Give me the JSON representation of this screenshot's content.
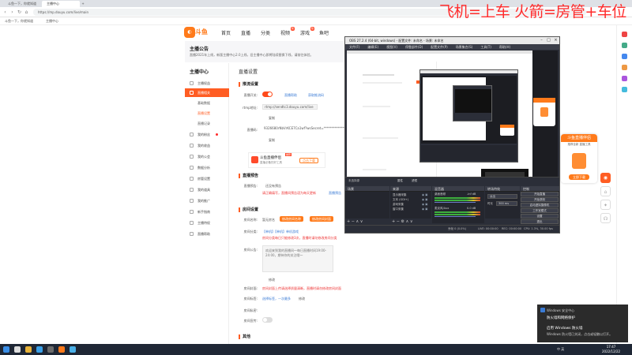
{
  "browser": {
    "tabs": [
      {
        "label": "斗鱼一下，你就知道"
      },
      {
        "label": "主播中心"
      }
    ],
    "url": "https://mp.douyu.com/live/main",
    "bookmarks": [
      "斗鱼一下，你就知道",
      "主播中心"
    ]
  },
  "overlay_text": "飞机=上车  火箭=房管+车位",
  "site": {
    "logo": "斗鱼",
    "nav": [
      "首页",
      "直播",
      "分类",
      "视频",
      "游戏",
      "鱼吧"
    ],
    "nav_badges": {
      "视频": "新",
      "游戏": "热"
    }
  },
  "banner": {
    "title": "主播公告",
    "desc": "直播2021年上线，新版主播中心2.0上线，旧主播中心即将陆续替换下线，请前往体验。"
  },
  "sidebar": {
    "heading": "主播中心",
    "items": [
      {
        "label": "主播权益",
        "active": false
      },
      {
        "label": "直播相关",
        "active": true
      }
    ],
    "subitems": [
      {
        "label": "基础数据",
        "active": false
      },
      {
        "label": "直播设置",
        "active": true
      },
      {
        "label": "直播记录",
        "active": false
      }
    ],
    "items2": [
      {
        "label": "我的粉丝",
        "dot": true
      },
      {
        "label": "我的收益",
        "dot": false
      },
      {
        "label": "我的公会",
        "dot": false
      },
      {
        "label": "数据分析",
        "dot": false
      },
      {
        "label": "房管设置",
        "dot": false
      },
      {
        "label": "我的道具",
        "dot": false
      },
      {
        "label": "我的推广",
        "dot": false
      },
      {
        "label": "新手指南",
        "dot": false
      },
      {
        "label": "主播特权",
        "dot": false
      },
      {
        "label": "直播帮助",
        "dot": false
      }
    ]
  },
  "content": {
    "title": "直播设置",
    "stream": {
      "heading": "推流设置",
      "switch_label": "直播开关:",
      "switch_links": [
        "直播帮助",
        "获取推流码"
      ],
      "rtmp_label": "rtmp地址:",
      "rtmp_value": "rtmp://sendtc3.douyu.com/live",
      "copy1": "复制",
      "code_label": "直播码:",
      "code_value": "9326680rNbVrKCE7Ca1wf?wsSecret=*****************",
      "copy2": "复制",
      "tool_title": "斗鱼直播伴侣",
      "tool_desc": "直播必备的好工具",
      "tool_badge": "推荐",
      "tool_btn": "点击下载"
    },
    "preview": {
      "heading": "直播预告",
      "label": "直播预告:",
      "value": "还没有预告",
      "hint": "请正确填写，直播间预告语为每天更新",
      "link": "直播预告"
    },
    "room": {
      "heading": "房间设置",
      "name_label": "房间名称:",
      "name_value": "暂无房名",
      "btn_modify": "修改房间名称",
      "btn_bulk": "修改房间封面",
      "cat_label": "房间分类:",
      "cat_value": "【单机】【单机】单机游戏",
      "cat_hint": "房间分类每日只能修改3次，直播时请勿修改房间分类",
      "notice_label": "房间公告:",
      "notice_value": "欢迎来到我的直播间～每日直播时间19:00-24:00，期待你的关注哦～",
      "save": "修改",
      "cover_label": "房间封面:",
      "cover_hint": "房间封面上传请选择质量清晰，直播时请勿修改房间封面",
      "tags_label": "房间标签:",
      "tags_value": "选择标签，一次最多",
      "tags_btn": "修改",
      "private_label": "房间私密:",
      "private2_label": "房间宣传:"
    },
    "other_heading": "其他"
  },
  "obs": {
    "title": "OBS 27.2.4 (64-bit, windows) - 配置文件: 未命名 - 场景: 未命名",
    "menu": [
      "文件(F)",
      "编辑(E)",
      "视图(V)",
      "停靠部件(D)",
      "配置文件(P)",
      "场景集合(S)",
      "工具(T)",
      "帮助(H)"
    ],
    "source_status": "未选择源",
    "props_btn": "属性",
    "filters_btn": "滤镜",
    "panels": {
      "scenes": "场景",
      "sources": "来源",
      "mixer": "混音器",
      "transitions": "转场特效",
      "controls": "控制"
    },
    "sources": [
      "显示器采集",
      "文本 (GDI+)",
      "游戏采集",
      "窗口采集"
    ],
    "mixer_tracks": [
      {
        "name": "桌面音频",
        "db": "-inf dB"
      },
      {
        "name": "麦克风/Aux",
        "db": "0.0 dB"
      }
    ],
    "transition": {
      "type": "淡出",
      "duration_label": "时长",
      "duration": "300 ms"
    },
    "controls": [
      "开始直播",
      "开始录制",
      "启动虚拟摄像机",
      "工作室模式",
      "设置",
      "退出"
    ],
    "status": {
      "live": "LIVE: 00:00:00",
      "rec": "REC: 00:00:00",
      "cpu": "CPU: 1.3%, 30.00 fps",
      "drop": "丢帧 0 (0.0%)"
    }
  },
  "promo": {
    "title": "斗鱼直播伴侣",
    "desc": "推荐全新 直播工具",
    "btn": "立即下载"
  },
  "toast": {
    "app": "Windows 安全中心",
    "title1": "防火墙和网络保护",
    "title2": "启用 Windows 防火墙",
    "body": "Windows 防火墙已关闭，点击或轻触以打开。"
  },
  "taskbar": {
    "time": "17:47",
    "date": "2022/12/22",
    "tray": "中 英"
  },
  "colors": {
    "accent": "#ff5d23",
    "obs_bg": "#2b2e38",
    "taskbar": "#1f2735"
  }
}
